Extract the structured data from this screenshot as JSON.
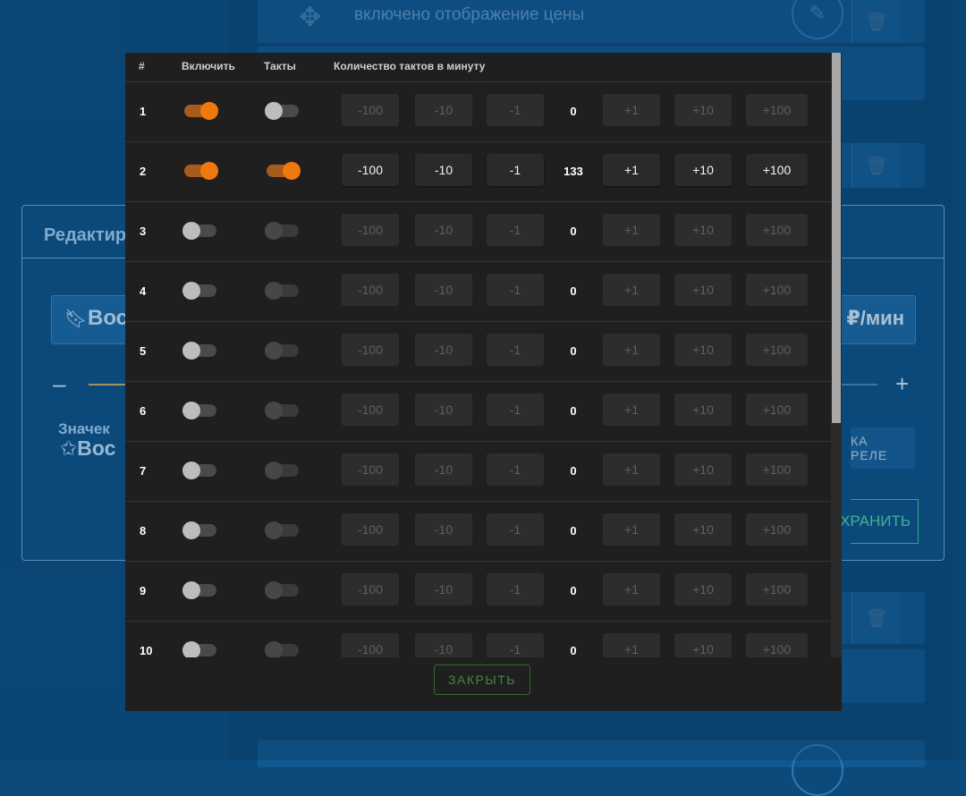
{
  "background": {
    "top_row_text": "включено отображение цены",
    "edit_panel": {
      "title": "Редактир",
      "name_value": "Вос",
      "unit": "₽/мин",
      "minus": "–",
      "plus": "+",
      "badge_label": "Значек",
      "badge_value": "Вос",
      "relay_button": "КА РЕЛЕ",
      "save_button": "ХРАНИТЬ"
    }
  },
  "modal": {
    "headers": {
      "num": "#",
      "enable": "Включить",
      "takts": "Такты",
      "count": "Количество тактов в минуту"
    },
    "buttons": [
      "-100",
      "-10",
      "-1",
      "+1",
      "+10",
      "+100"
    ],
    "rows": [
      {
        "num": "1",
        "enabled": true,
        "takts": false,
        "value": "0"
      },
      {
        "num": "2",
        "enabled": true,
        "takts": true,
        "value": "133"
      },
      {
        "num": "3",
        "enabled": false,
        "takts": false,
        "value": "0"
      },
      {
        "num": "4",
        "enabled": false,
        "takts": false,
        "value": "0"
      },
      {
        "num": "5",
        "enabled": false,
        "takts": false,
        "value": "0"
      },
      {
        "num": "6",
        "enabled": false,
        "takts": false,
        "value": "0"
      },
      {
        "num": "7",
        "enabled": false,
        "takts": false,
        "value": "0"
      },
      {
        "num": "8",
        "enabled": false,
        "takts": false,
        "value": "0"
      },
      {
        "num": "9",
        "enabled": false,
        "takts": false,
        "value": "0"
      },
      {
        "num": "10",
        "enabled": false,
        "takts": false,
        "value": "0"
      }
    ],
    "close_label": "ЗАКРЫТЬ"
  },
  "colors": {
    "accent_orange": "#f0790f",
    "modal_bg": "#1f1f1f",
    "close_green": "#3f8a3f"
  }
}
